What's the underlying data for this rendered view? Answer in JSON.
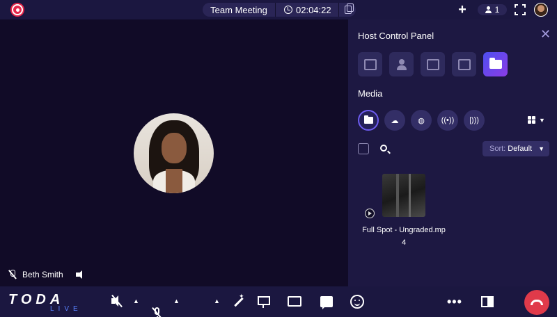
{
  "topbar": {
    "meeting_title": "Team Meeting",
    "elapsed_time": "02:04:22",
    "participant_count": "1"
  },
  "stage": {
    "participant_name": "Beth Smith"
  },
  "panel": {
    "title": "Host Control Panel",
    "section_title": "Media",
    "sort_label": "Sort:",
    "sort_value": "Default",
    "media_items": [
      {
        "name": "Full Spot - Ungraded.mp4"
      }
    ]
  },
  "bottombar": {
    "logo_main": "TODA",
    "logo_sub": "LIVE",
    "more_label": "•••"
  },
  "colors": {
    "background": "#0f0b25",
    "bar": "#1b1740",
    "panel": "#1d1842",
    "record": "#e4264b",
    "accent_gradient_start": "#4d4ff0",
    "accent_gradient_end": "#8b3de6",
    "hangup": "#e03a4a"
  },
  "icons": {
    "record": "record-icon",
    "clock": "clock-icon",
    "copy": "copy-icon",
    "add": "plus-icon",
    "participants": "user-icon",
    "fullscreen": "fullscreen-icon",
    "close": "close-icon",
    "hangup": "phone-hangup-icon"
  }
}
